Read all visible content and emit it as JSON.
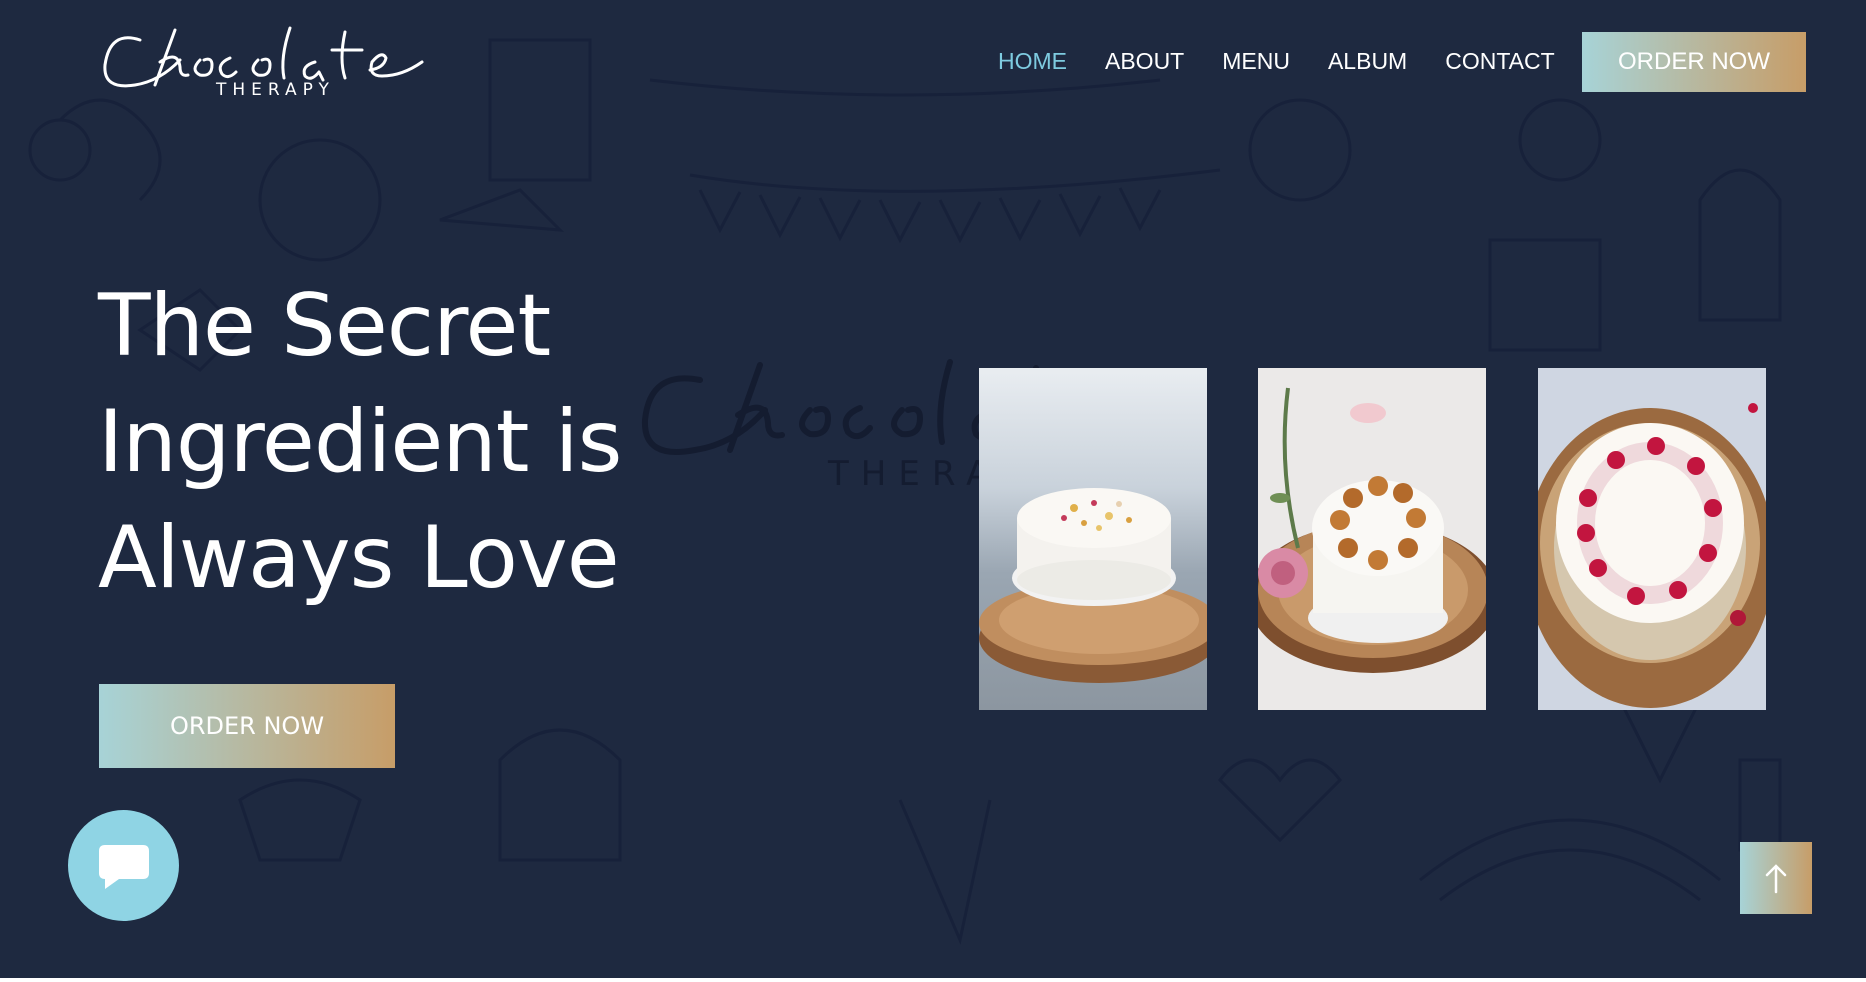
{
  "brand": {
    "logo_script": "Chocolate",
    "logo_sub": "THERAPY"
  },
  "nav": {
    "items": [
      {
        "label": "HOME",
        "active": true
      },
      {
        "label": "ABOUT",
        "active": false
      },
      {
        "label": "MENU",
        "active": false
      },
      {
        "label": "ALBUM",
        "active": false
      },
      {
        "label": "CONTACT",
        "active": false
      }
    ],
    "order_label": "ORDER NOW"
  },
  "hero": {
    "title_lines": [
      "The Secret",
      "Ingredient is",
      "Always Love"
    ],
    "order_label": "ORDER NOW",
    "watermark_sub": "THERA"
  },
  "cakes": [
    {
      "name": "cake-photo-1"
    },
    {
      "name": "cake-photo-2"
    },
    {
      "name": "cake-photo-3"
    }
  ],
  "colors": {
    "background": "#1e2940",
    "nav_active": "#7ecbe0",
    "button_gradient_start": "#a7d3d7",
    "button_gradient_end": "#c79d68",
    "chat_button": "#8fd4e4"
  },
  "icons": {
    "chat": "chat-bubble-icon",
    "scroll_top": "arrow-up-icon"
  }
}
